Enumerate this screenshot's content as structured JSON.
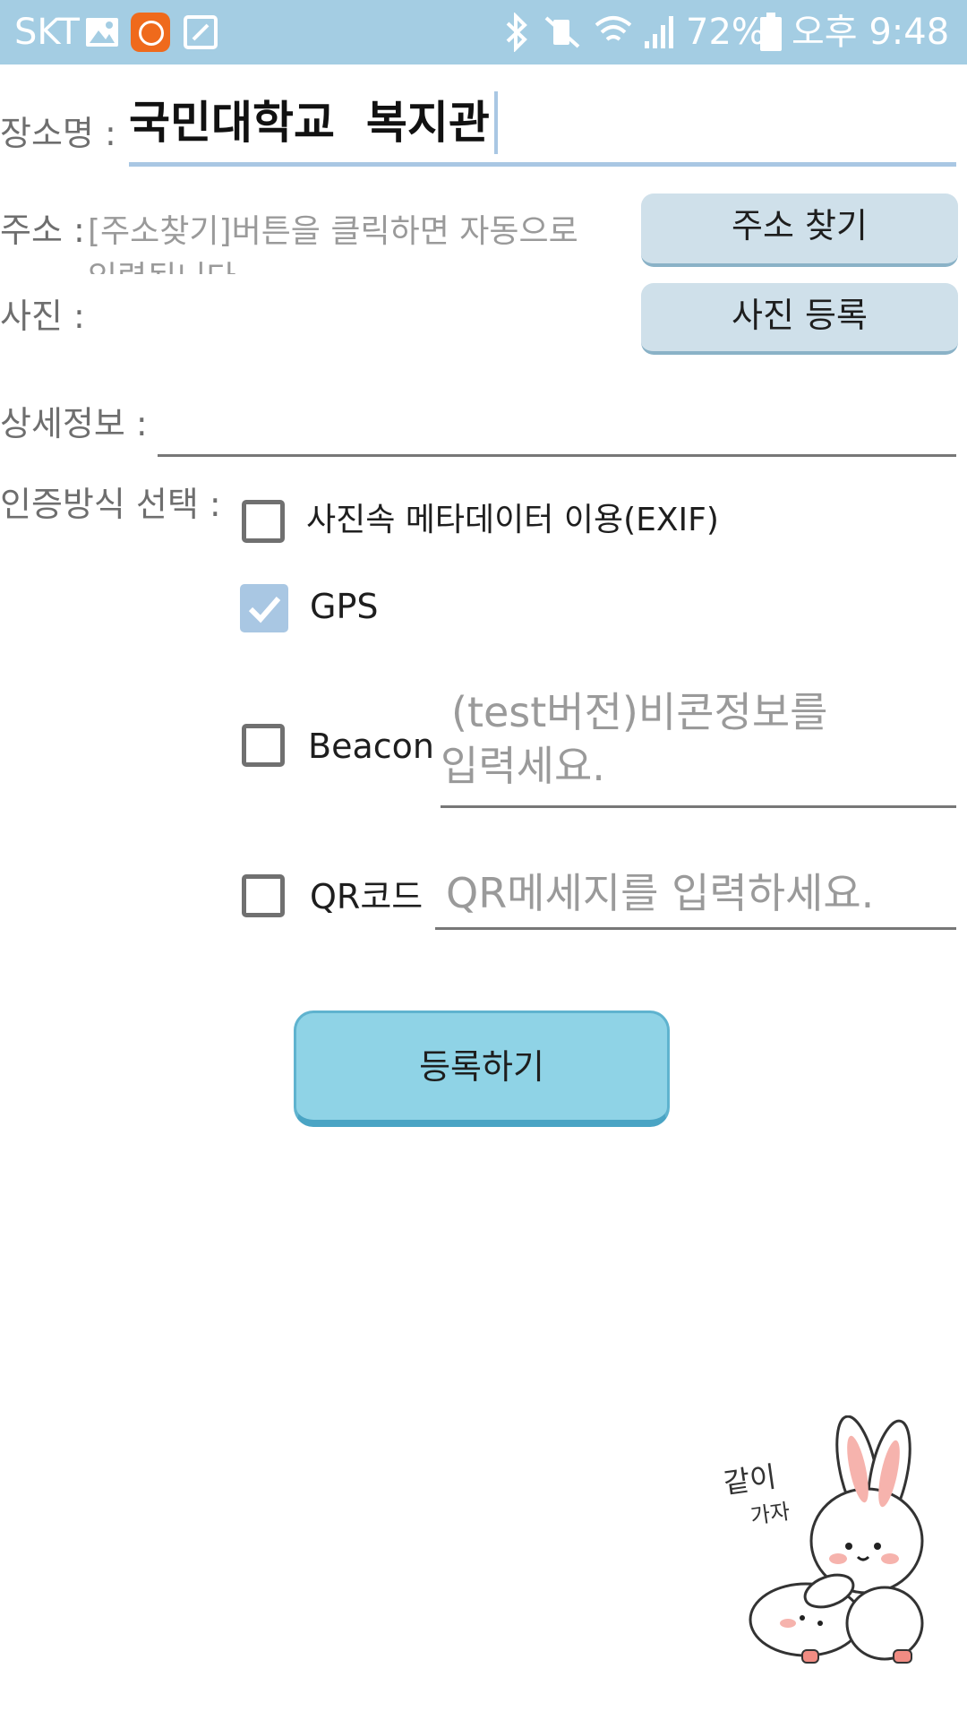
{
  "status_bar": {
    "carrier": "SKT",
    "battery": "72%",
    "time": "오후 9:48",
    "bg_color": "#a4cde3",
    "icons": [
      "gallery-icon",
      "mi-app-icon",
      "edit-icon",
      "bluetooth-icon",
      "vibrate-icon",
      "wifi-icon",
      "signal-icon",
      "battery-icon"
    ]
  },
  "form": {
    "place_name": {
      "label": "장소명 :",
      "value": "국민대학교  복지관"
    },
    "address": {
      "label": "주소 :",
      "placeholder_line1": "[주소찾기]버튼을 클릭하면 자동으로",
      "placeholder_line2": "입력됩니다",
      "button": "주소 찾기"
    },
    "photo": {
      "label": "사진 :",
      "button": "사진 등록"
    },
    "detail": {
      "label": "상세정보 :",
      "value": ""
    },
    "auth": {
      "label": "인증방식 선택 :",
      "options": [
        {
          "label": "사진속 메타데이터 이용(EXIF)",
          "checked": false
        },
        {
          "label": "GPS",
          "checked": true
        },
        {
          "label": "Beacon",
          "checked": false,
          "placeholder_line1": "(test버전)비콘정보를",
          "placeholder_line2": "입력세요."
        },
        {
          "label": "QR코드",
          "checked": false,
          "placeholder": "QR메세지를 입력하세요."
        }
      ]
    },
    "submit": "등록하기"
  },
  "sticker_text": {
    "line1": "같이",
    "line2": "가자"
  },
  "colors": {
    "accent": "#8fd3e6",
    "field_underline": "#a9c7e3",
    "checkbox_checked": "#a9c7e3"
  }
}
